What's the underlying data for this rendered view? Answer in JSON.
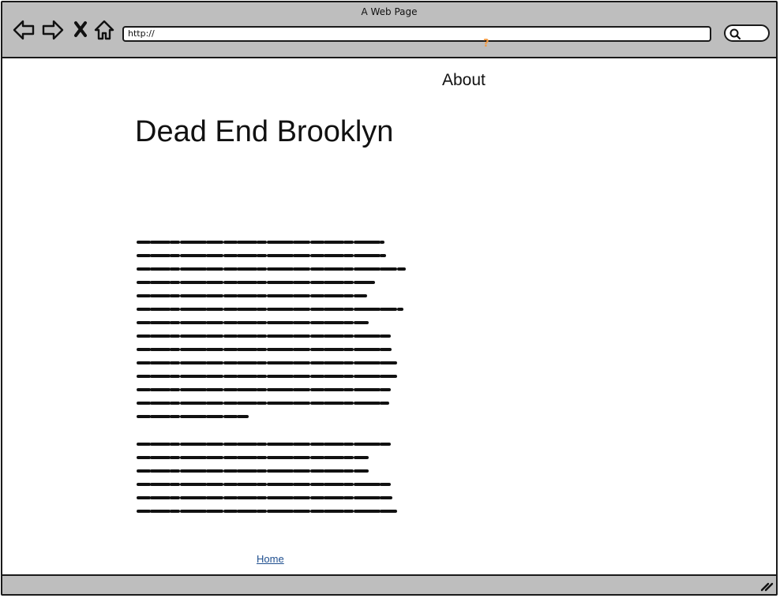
{
  "window": {
    "title": "A Web Page"
  },
  "toolbar": {
    "back_icon": "back-arrow-icon",
    "forward_icon": "forward-arrow-icon",
    "stop_icon": "close-icon",
    "home_icon": "home-icon",
    "url": "http://",
    "search_icon": "search-icon",
    "help_mark": "?"
  },
  "nav": {
    "about_label": "About",
    "home_label": "Home"
  },
  "page": {
    "title": "Dead End Brooklyn",
    "paragraphs_note_icon": "scribble-placeholder-text"
  },
  "colors": {
    "chrome": "#bebebe",
    "border": "#1a1a1a",
    "link": "#1f4f8f",
    "help": "#f59b42"
  }
}
